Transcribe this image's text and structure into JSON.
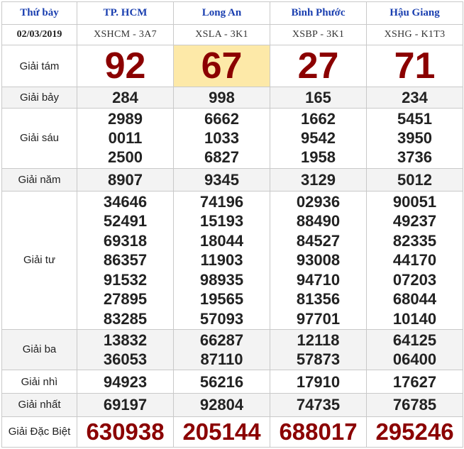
{
  "header": {
    "day": "Thứ bảy",
    "date": "02/03/2019",
    "provinces": [
      "TP. HCM",
      "Long An",
      "Bình Phước",
      "Hậu Giang"
    ],
    "codes": [
      "XSHCM - 3A7",
      "XSLA - 3K1",
      "XSBP - 3K1",
      "XSHG - K1T3"
    ]
  },
  "prizes": {
    "g8": {
      "label": "Giải tám",
      "values": [
        [
          "92"
        ],
        [
          "67"
        ],
        [
          "27"
        ],
        [
          "71"
        ]
      ]
    },
    "g7": {
      "label": "Giải bảy",
      "values": [
        [
          "284"
        ],
        [
          "998"
        ],
        [
          "165"
        ],
        [
          "234"
        ]
      ]
    },
    "g6": {
      "label": "Giải sáu",
      "values": [
        [
          "2989",
          "0011",
          "2500"
        ],
        [
          "6662",
          "1033",
          "6827"
        ],
        [
          "1662",
          "9542",
          "1958"
        ],
        [
          "5451",
          "3950",
          "3736"
        ]
      ]
    },
    "g5": {
      "label": "Giải năm",
      "values": [
        [
          "8907"
        ],
        [
          "9345"
        ],
        [
          "3129"
        ],
        [
          "5012"
        ]
      ]
    },
    "g4": {
      "label": "Giải tư",
      "values": [
        [
          "34646",
          "52491",
          "69318",
          "86357",
          "91532",
          "27895",
          "83285"
        ],
        [
          "74196",
          "15193",
          "18044",
          "11903",
          "98935",
          "19565",
          "57093"
        ],
        [
          "02936",
          "88490",
          "84527",
          "93008",
          "94710",
          "81356",
          "97701"
        ],
        [
          "90051",
          "49237",
          "82335",
          "44170",
          "07203",
          "68044",
          "10140"
        ]
      ]
    },
    "g3": {
      "label": "Giải ba",
      "values": [
        [
          "13832",
          "36053"
        ],
        [
          "66287",
          "87110"
        ],
        [
          "12118",
          "57873"
        ],
        [
          "64125",
          "06400"
        ]
      ]
    },
    "g2": {
      "label": "Giải nhì",
      "values": [
        [
          "94923"
        ],
        [
          "56216"
        ],
        [
          "17910"
        ],
        [
          "17627"
        ]
      ]
    },
    "g1": {
      "label": "Giải nhất",
      "values": [
        [
          "69197"
        ],
        [
          "92804"
        ],
        [
          "74735"
        ],
        [
          "76785"
        ]
      ]
    },
    "db": {
      "label": "Giải Đặc Biệt",
      "values": [
        [
          "630938"
        ],
        [
          "205144"
        ],
        [
          "688017"
        ],
        [
          "295246"
        ]
      ]
    }
  },
  "colors": {
    "header_text": "#1a3fb0",
    "prize_red": "#8b0000",
    "highlight": "#fde9a8",
    "alt_row": "#f3f3f3",
    "border": "#c9c9c9"
  }
}
